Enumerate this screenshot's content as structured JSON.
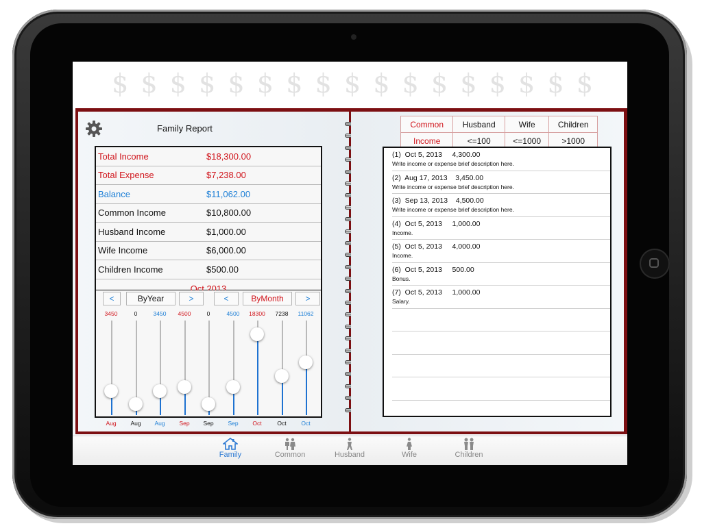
{
  "header": {
    "dollar_signs": [
      "$",
      "$",
      "$",
      "$",
      "$",
      "$",
      "$",
      "$",
      "$",
      "$",
      "$",
      "$",
      "$",
      "$",
      "$",
      "$",
      "$"
    ]
  },
  "report": {
    "title": "Family Report",
    "rows": [
      {
        "label": "Total Income",
        "value": "$18,300.00",
        "color": "red"
      },
      {
        "label": "Total Expense",
        "value": "$7,238.00",
        "color": "red"
      },
      {
        "label": "Balance",
        "value": "$11,062.00",
        "color": "blue"
      },
      {
        "label": "Common Income",
        "value": "$10,800.00",
        "color": "dark"
      },
      {
        "label": "Husband Income",
        "value": "$1,000.00",
        "color": "dark"
      },
      {
        "label": "Wife Income",
        "value": "$6,000.00",
        "color": "dark"
      },
      {
        "label": "Children Income",
        "value": "$500.00",
        "color": "dark"
      }
    ],
    "period": "Oct,2013"
  },
  "controls": {
    "prev_year": "<",
    "by_year": "ByYear",
    "next_year": ">",
    "prev_month": "<",
    "by_month": "ByMonth",
    "next_month": ">"
  },
  "sliders": [
    {
      "value": "3450",
      "level": 0.19,
      "month": "Aug",
      "color": "#d0141b"
    },
    {
      "value": "0",
      "level": 0.0,
      "month": "Aug",
      "color": "#111111"
    },
    {
      "value": "3450",
      "level": 0.19,
      "month": "Aug",
      "color": "#1d7fd6"
    },
    {
      "value": "4500",
      "level": 0.25,
      "month": "Sep",
      "color": "#d0141b"
    },
    {
      "value": "0",
      "level": 0.0,
      "month": "Sep",
      "color": "#111111"
    },
    {
      "value": "4500",
      "level": 0.25,
      "month": "Sep",
      "color": "#1d7fd6"
    },
    {
      "value": "18300",
      "level": 1.0,
      "month": "Oct",
      "color": "#d0141b"
    },
    {
      "value": "7238",
      "level": 0.4,
      "month": "Oct",
      "color": "#111111"
    },
    {
      "value": "11062",
      "level": 0.6,
      "month": "Oct",
      "color": "#1d7fd6"
    }
  ],
  "categories": {
    "headers": [
      "Common",
      "Husband",
      "Wife",
      "Children"
    ],
    "ranges": [
      "Income",
      "<=100",
      "<=1000",
      ">1000"
    ]
  },
  "entries": [
    {
      "line1": "(1)  Oct 5, 2013     4,300.00",
      "line2": "Write income or expense brief description here."
    },
    {
      "line1": "(2)  Aug 17, 2013    3,450.00",
      "line2": "Write income or expense brief description here."
    },
    {
      "line1": "(3)  Sep 13, 2013    4,500.00",
      "line2": "Write income or expense brief description here."
    },
    {
      "line1": "(4)  Oct 5, 2013     1,000.00",
      "line2": "Income."
    },
    {
      "line1": "(5)  Oct 5, 2013     4,000.00",
      "line2": "Income."
    },
    {
      "line1": "(6)  Oct 5, 2013     500.00",
      "line2": "Bonus."
    },
    {
      "line1": "(7)  Oct 5, 2013     1,000.00",
      "line2": "Salary."
    },
    {
      "line1": "",
      "line2": ""
    },
    {
      "line1": "",
      "line2": ""
    },
    {
      "line1": "",
      "line2": ""
    },
    {
      "line1": "",
      "line2": ""
    }
  ],
  "tabs": [
    {
      "label": "Family",
      "icon": "house-icon",
      "active": true
    },
    {
      "label": "Common",
      "icon": "couple-icon",
      "active": false
    },
    {
      "label": "Husband",
      "icon": "man-icon",
      "active": false
    },
    {
      "label": "Wife",
      "icon": "woman-icon",
      "active": false
    },
    {
      "label": "Children",
      "icon": "children-icon",
      "active": false
    }
  ],
  "colors": {
    "accent_red": "#d0141b",
    "accent_blue": "#1d7fd6",
    "book_cover": "#7c0f12",
    "tab_active": "#2d7ad3"
  }
}
